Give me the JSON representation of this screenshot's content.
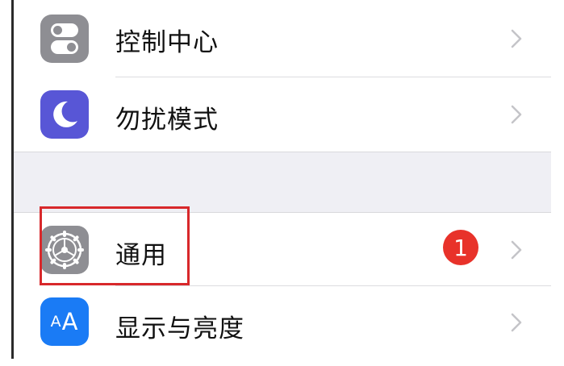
{
  "settings": {
    "items": [
      {
        "label": "控制中心",
        "icon": "toggle-switches-icon",
        "icon_color": "#8e8e93"
      },
      {
        "label": "勿扰模式",
        "icon": "crescent-moon-icon",
        "icon_color": "#5856d6"
      },
      {
        "label": "通用",
        "icon": "gear-icon",
        "icon_color": "#8e8e93",
        "badge": "1",
        "badge_color": "#e8322a",
        "highlighted": true
      },
      {
        "label": "显示与亮度",
        "icon": "text-size-icon",
        "icon_color": "#1a7bf5",
        "icon_text_small": "A",
        "icon_text_large": "A"
      }
    ]
  },
  "colors": {
    "group_separator": "#efeff4",
    "chevron": "#c4c4c8",
    "highlight_border": "#d8282b"
  }
}
